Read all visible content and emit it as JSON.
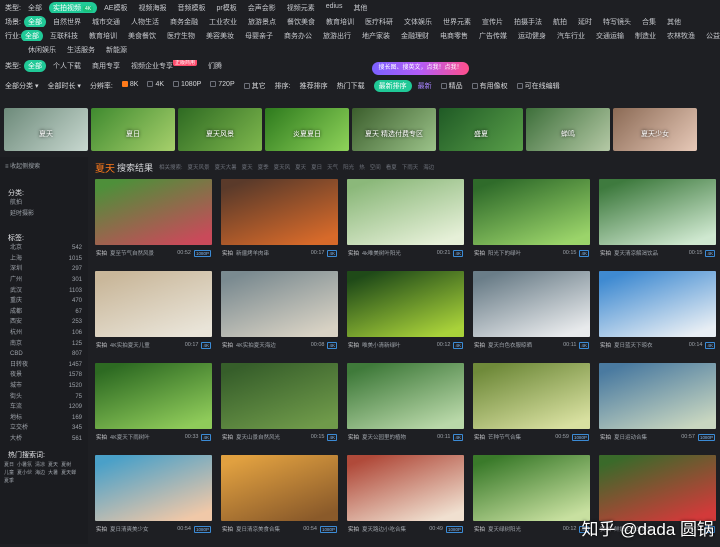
{
  "types": {
    "label": "类型:",
    "items": [
      "全部",
      "实拍视频",
      "AE模板",
      "视频海报",
      "音频模板",
      "pr模板",
      "会声会影",
      "视频元素",
      "edius",
      "其他"
    ],
    "active": 1,
    "badge": "4K"
  },
  "scenes": {
    "label": "场景:",
    "items": [
      "全部",
      "自然世界",
      "城市交通",
      "人物生活",
      "商务金融",
      "工业农业",
      "旅游景点",
      "餐饮美食",
      "教育培训",
      "医疗科研",
      "文体娱乐",
      "世界元素",
      "宣传片",
      "拍摄手法",
      "航拍",
      "延时",
      "特写镜头",
      "合集",
      "其他"
    ],
    "active": 0
  },
  "industry": {
    "label": "行业:",
    "items": [
      "全部",
      "互联科技",
      "教育培训",
      "美食餐饮",
      "医疗生物",
      "美容美妆",
      "母婴亲子",
      "商务办公",
      "旅游出行",
      "地产家装",
      "金融理财",
      "电商零售",
      "广告传媒",
      "运动健身",
      "汽车行业",
      "交通运输",
      "制造业",
      "农林牧渔",
      "公益环保",
      "休闲娱乐",
      "生活服务",
      "新能源"
    ],
    "active": 0
  },
  "source": {
    "label": "类型:",
    "items": [
      "全部",
      "个人下载",
      "商用专享",
      "视频企业专享",
      "们腾"
    ],
    "active": 0,
    "hot": "正版商用"
  },
  "banner": "搜长图、搜英文，点我！点我！",
  "filters": {
    "all_cat": "全部分类 ▾",
    "all_len": "全部时长 ▾",
    "res": "分辨率:",
    "resopts": [
      "8K",
      "4K",
      "1080P",
      "720P",
      "其它"
    ],
    "sort": "排序:",
    "sorts": [
      "推荐排序",
      "热门下载",
      "最新排序"
    ],
    "newest": "最新",
    "hd": "精品",
    "auth": "有用像权",
    "editable": "可在线编辑"
  },
  "categories": [
    {
      "label": "夏天",
      "c1": "#6d8a7a",
      "c2": "#c8d8d0"
    },
    {
      "label": "夏日",
      "c1": "#3f8a2f",
      "c2": "#a7d06c"
    },
    {
      "label": "夏天风景",
      "c1": "#2e6a22",
      "c2": "#7fb84e"
    },
    {
      "label": "炎夏夏日",
      "c1": "#2d7a1d",
      "c2": "#8fd35a"
    },
    {
      "label": "夏天 精选付费专区",
      "c1": "#3b5e2c",
      "c2": "#9cc38a"
    },
    {
      "label": "盛夏",
      "c1": "#1f5a25",
      "c2": "#5aa04a"
    },
    {
      "label": "蝉鸣",
      "c1": "#3d6f3a",
      "c2": "#b5c9a6"
    },
    {
      "label": "夏天少女",
      "c1": "#8b6a55",
      "c2": "#e7c9b8"
    }
  ],
  "sidebar": {
    "toggle": "≡ 收起侧搜索",
    "cat_title": "分类:",
    "cats": [
      "航拍",
      "延时摄影"
    ],
    "region_title": "标签:",
    "regions": [
      [
        "北京",
        "542"
      ],
      [
        "上海",
        "1015"
      ],
      [
        "深圳",
        "297"
      ],
      [
        "广州",
        "301"
      ],
      [
        "武汉",
        "1103"
      ],
      [
        "重庆",
        "470"
      ],
      [
        "成都",
        "67"
      ],
      [
        "西安",
        "253"
      ],
      [
        "杭州",
        "106"
      ],
      [
        "南京",
        "125"
      ],
      [
        "CBD",
        "807"
      ],
      [
        "日转夜",
        "1457"
      ],
      [
        "夜景",
        "1578"
      ],
      [
        "城市",
        "1520"
      ],
      [
        "街头",
        "75"
      ],
      [
        "车流",
        "1209"
      ],
      [
        "地标",
        "169"
      ],
      [
        "立交桥",
        "345"
      ],
      [
        "大桥",
        "561"
      ]
    ],
    "hot_title": "热门搜索词:",
    "hot": [
      "夏日",
      "小暑氛",
      "清凉",
      "夏天",
      "夏树",
      "儿童",
      "夏小伙",
      "海边",
      "大暑",
      "夏天蝉",
      "夏季"
    ]
  },
  "result": {
    "title": "夏天",
    "suffix": "搜索结果",
    "tags": [
      "相关搜索:",
      "夏天风景",
      "夏天大暑",
      "夏天",
      "夏季",
      "夏天风",
      "夏天",
      "夏日",
      "天气",
      "阳光",
      "热",
      "空间",
      "看夏",
      "下雨天",
      "海边"
    ]
  },
  "videos": [
    {
      "type": "实拍",
      "title": "夏至节气自然风景",
      "dur": "00:52",
      "q": "1080P",
      "c1": "#4e8f3a",
      "c2": "#c94a5a"
    },
    {
      "type": "实拍",
      "title": "新疆烤羊肉串",
      "dur": "00:17",
      "q": "4K",
      "c1": "#5a3a2a",
      "c2": "#d76a2a"
    },
    {
      "type": "实拍",
      "title": "4k唯美树叶阳光",
      "dur": "00:21",
      "q": "4K",
      "c1": "#8bb87a",
      "c2": "#e6f0d8"
    },
    {
      "type": "实拍",
      "title": "阳光下的绿叶",
      "dur": "00:15",
      "q": "4K",
      "c1": "#2f6b2a",
      "c2": "#9bd46a"
    },
    {
      "type": "实拍",
      "title": "夏天清凉解渴饮品",
      "dur": "00:15",
      "q": "4K",
      "c1": "#3e7a3e",
      "c2": "#cfe8d0"
    },
    {
      "type": "实拍",
      "title": "4K实拍夏天儿童",
      "dur": "00:17",
      "q": "4K",
      "c1": "#c9b79a",
      "c2": "#e9e4d8"
    },
    {
      "type": "实拍",
      "title": "4K实拍夏天海边",
      "dur": "00:08",
      "q": "4K",
      "c1": "#7a8a90",
      "c2": "#d8d2c4"
    },
    {
      "type": "实拍",
      "title": "唯美小清新绿叶",
      "dur": "00:12",
      "q": "4K",
      "c1": "#1f4a18",
      "c2": "#a9d23a"
    },
    {
      "type": "实拍",
      "title": "夏天白色衣服晾晒",
      "dur": "00:11",
      "q": "4K",
      "c1": "#6a7d88",
      "c2": "#e8eaec"
    },
    {
      "type": "实拍",
      "title": "夏日蓝天下晾衣",
      "dur": "00:14",
      "q": "4K",
      "c1": "#3f8ad1",
      "c2": "#e8eef4"
    },
    {
      "type": "实拍",
      "title": "4K夏天下雨树叶",
      "dur": "00:33",
      "q": "4K",
      "c1": "#2d6a22",
      "c2": "#8fcb5a"
    },
    {
      "type": "实拍",
      "title": "夏天山景自然风光",
      "dur": "00:15",
      "q": "4K",
      "c1": "#365e2a",
      "c2": "#6f9a4a"
    },
    {
      "type": "实拍",
      "title": "夏天公园里的植物",
      "dur": "00:11",
      "q": "4K",
      "c1": "#3f7a3a",
      "c2": "#b9d8a9"
    },
    {
      "type": "实拍",
      "title": "芒种节气合集",
      "dur": "00:59",
      "q": "1080P",
      "c1": "#6f8a3a",
      "c2": "#d8e0a0"
    },
    {
      "type": "实拍",
      "title": "夏日运动合集",
      "dur": "00:57",
      "q": "1080P",
      "c1": "#4a7aa0",
      "c2": "#c8d6c0"
    },
    {
      "type": "实拍",
      "title": "夏日清爽美少女",
      "dur": "00:54",
      "q": "1080P",
      "c1": "#4aa0c8",
      "c2": "#f0c8a8"
    },
    {
      "type": "实拍",
      "title": "夏日清凉美食合集",
      "dur": "00:54",
      "q": "1080P",
      "c1": "#e0a040",
      "c2": "#8a5a2a"
    },
    {
      "type": "实拍",
      "title": "夏天路边小吃合集",
      "dur": "00:49",
      "q": "1080P",
      "c1": "#b04a3a",
      "c2": "#f0e0d0"
    },
    {
      "type": "实拍",
      "title": "夏天绿树阳光",
      "dur": "00:12",
      "q": "4K",
      "c1": "#3a7a2a",
      "c2": "#c8e0a0"
    },
    {
      "type": "实拍",
      "title": "鲜嫩上市的草莓",
      "dur": "00:12",
      "q": "4K",
      "c1": "#3a6a2a",
      "c2": "#d23a3a"
    }
  ],
  "watermark": "知乎 @dada 圆锅"
}
